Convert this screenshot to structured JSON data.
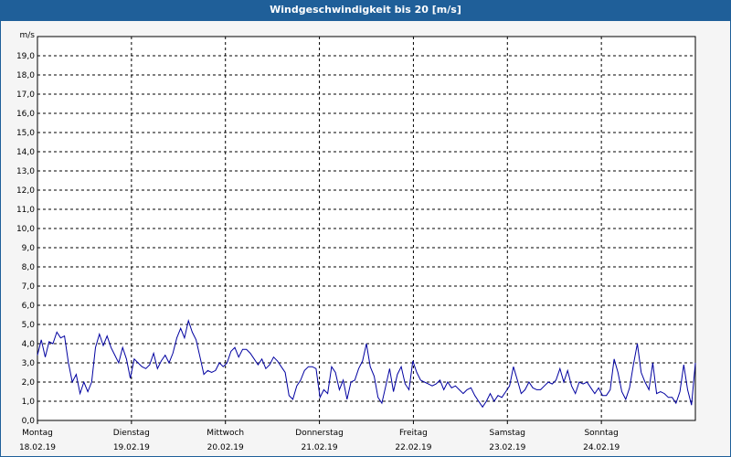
{
  "window": {
    "title": "Windgeschwindigkeit bis 20 [m/s]"
  },
  "colors": {
    "titlebar": "#1f5f99",
    "line": "#0000a0",
    "grid": "#000000"
  },
  "chart_data": {
    "type": "line",
    "title": "Windgeschwindigkeit bis 20 [m/s]",
    "ylabel": "m/s",
    "ylim": [
      0,
      20
    ],
    "yticks": [
      "0,0",
      "1,0",
      "2,0",
      "3,0",
      "4,0",
      "5,0",
      "6,0",
      "7,0",
      "8,0",
      "9,0",
      "10,0",
      "11,0",
      "12,0",
      "13,0",
      "14,0",
      "15,0",
      "16,0",
      "17,0",
      "18,0",
      "19,0"
    ],
    "xlim": [
      0,
      7
    ],
    "grid": true,
    "days": [
      {
        "name": "Montag",
        "date": "18.02.19"
      },
      {
        "name": "Dienstag",
        "date": "19.02.19"
      },
      {
        "name": "Mittwoch",
        "date": "20.02.19"
      },
      {
        "name": "Donnerstag",
        "date": "21.02.19"
      },
      {
        "name": "Freitag",
        "date": "22.02.19"
      },
      {
        "name": "Samstag",
        "date": "23.02.19"
      },
      {
        "name": "Sonntag",
        "date": "24.02.19"
      }
    ],
    "series": [
      {
        "values": [
          3.4,
          4.2,
          3.3,
          4.1,
          4.0,
          4.6,
          4.3,
          4.4,
          3.0,
          2.0,
          2.4,
          1.4,
          2.0,
          1.5,
          2.0,
          3.8,
          4.5,
          3.9,
          4.4,
          3.8,
          3.4,
          3.0,
          3.8,
          3.2,
          2.2,
          3.2,
          3.0,
          2.8,
          2.7,
          2.9,
          3.5,
          2.7,
          3.1,
          3.4,
          3.0,
          3.5,
          4.3,
          4.8,
          4.3,
          5.2,
          4.6,
          4.2,
          3.3,
          2.4,
          2.6,
          2.5,
          2.6,
          3.0,
          2.8,
          3.0,
          3.6,
          3.8,
          3.3,
          3.7,
          3.7,
          3.5,
          3.2,
          2.9,
          3.2,
          2.7,
          2.9,
          3.3,
          3.1,
          2.8,
          2.5,
          1.3,
          1.1,
          1.8,
          2.1,
          2.6,
          2.8,
          2.8,
          2.7,
          1.2,
          1.6,
          1.4,
          2.8,
          2.5,
          1.6,
          2.1,
          1.1,
          2.0,
          2.1,
          2.7,
          3.1,
          4.0,
          2.8,
          2.3,
          1.2,
          0.9,
          1.8,
          2.7,
          1.5,
          2.4,
          2.8,
          1.9,
          1.6,
          3.1,
          2.5,
          2.1,
          2.0,
          1.9,
          1.8,
          1.9,
          2.1,
          1.6,
          2.0,
          1.7,
          1.8,
          1.6,
          1.4,
          1.6,
          1.7,
          1.3,
          1.0,
          0.7,
          1.0,
          1.4,
          1.0,
          1.3,
          1.2,
          1.5,
          1.8,
          2.8,
          2.1,
          1.4,
          1.6,
          2.0,
          1.7,
          1.6,
          1.6,
          1.8,
          2.0,
          1.9,
          2.1,
          2.7,
          2.0,
          2.6,
          1.8,
          1.4,
          2.0,
          1.9,
          2.0,
          1.7,
          1.4,
          1.7,
          1.3,
          1.3,
          1.6,
          3.2,
          2.5,
          1.5,
          1.1,
          1.7,
          2.9,
          4.0,
          2.5,
          2.0,
          1.6,
          3.0,
          1.4,
          1.5,
          1.4,
          1.2,
          1.2,
          0.9,
          1.5,
          2.9,
          1.6,
          0.8,
          3.0
        ]
      }
    ]
  }
}
